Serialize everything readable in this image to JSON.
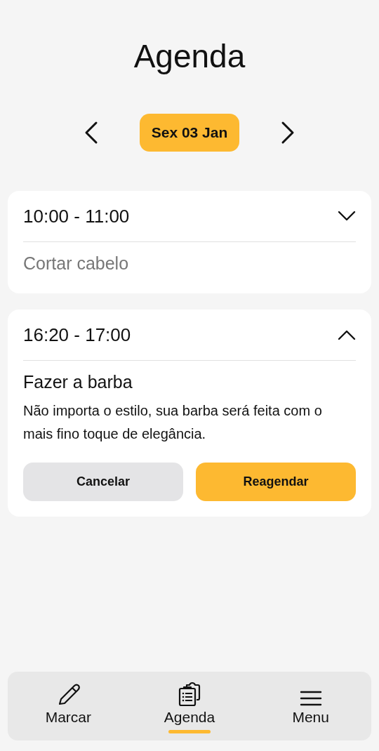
{
  "title": "Agenda",
  "date_nav": {
    "date": "Sex 03 Jan"
  },
  "appointments": [
    {
      "time": "10:00 - 11:00",
      "service": "Cortar cabelo",
      "expanded": false
    },
    {
      "time": "16:20 - 17:00",
      "service": "Fazer a barba",
      "expanded": true,
      "description": "Não importa o estilo, sua barba será feita com o mais fino toque de elegância.",
      "actions": [
        {
          "label": "Cancelar",
          "kind": "secondary"
        },
        {
          "label": "Reagendar",
          "kind": "primary"
        }
      ]
    }
  ],
  "bottom_nav": [
    {
      "label": "Marcar",
      "kind": "pencil",
      "selected": false
    },
    {
      "label": "Agenda",
      "kind": "clipboard",
      "selected": true
    },
    {
      "label": "Menu",
      "kind": "menu",
      "selected": false
    }
  ]
}
